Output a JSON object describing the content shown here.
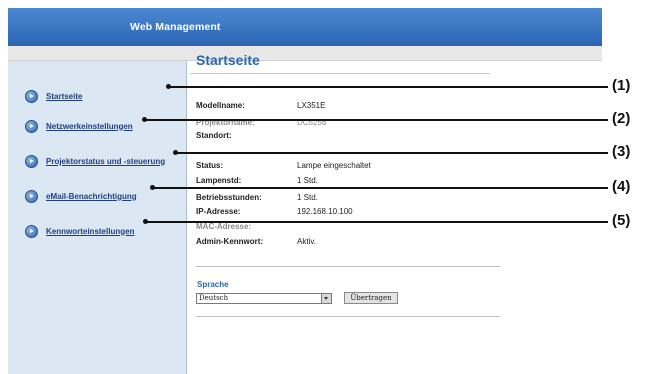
{
  "header": {
    "title": "Web Management"
  },
  "sidebar": {
    "items": [
      {
        "label": "Startseite"
      },
      {
        "label": "Netzwerkeinstellungen"
      },
      {
        "label": "Projektorstatus und -steuerung"
      },
      {
        "label": "eMail-Benachrichtigung"
      },
      {
        "label": "Kennworteinstellungen"
      }
    ]
  },
  "main": {
    "title": "Startseite",
    "info": [
      {
        "label": "Modellname:",
        "value": "LX351E"
      },
      {
        "label": "Projektorname:",
        "value": "DC5256"
      },
      {
        "label": "Standort:",
        "value": ""
      },
      {
        "label": "Status:",
        "value": "Lampe eingeschaltet"
      },
      {
        "label": "Lampenstd:",
        "value": "1 Std."
      },
      {
        "label": "Betriebsstunden:",
        "value": "1 Std."
      },
      {
        "label": "IP-Adresse:",
        "value": "192.168.10.100"
      },
      {
        "label": "MAC-Adresse:",
        "value": ""
      },
      {
        "label": "Admin-Kennwort:",
        "value": "Aktiv."
      }
    ]
  },
  "language": {
    "label": "Sprache",
    "selected": "Deutsch",
    "apply_label": "Übertragen"
  },
  "callouts": [
    "(1)",
    "(2)",
    "(3)",
    "(4)",
    "(5)"
  ]
}
